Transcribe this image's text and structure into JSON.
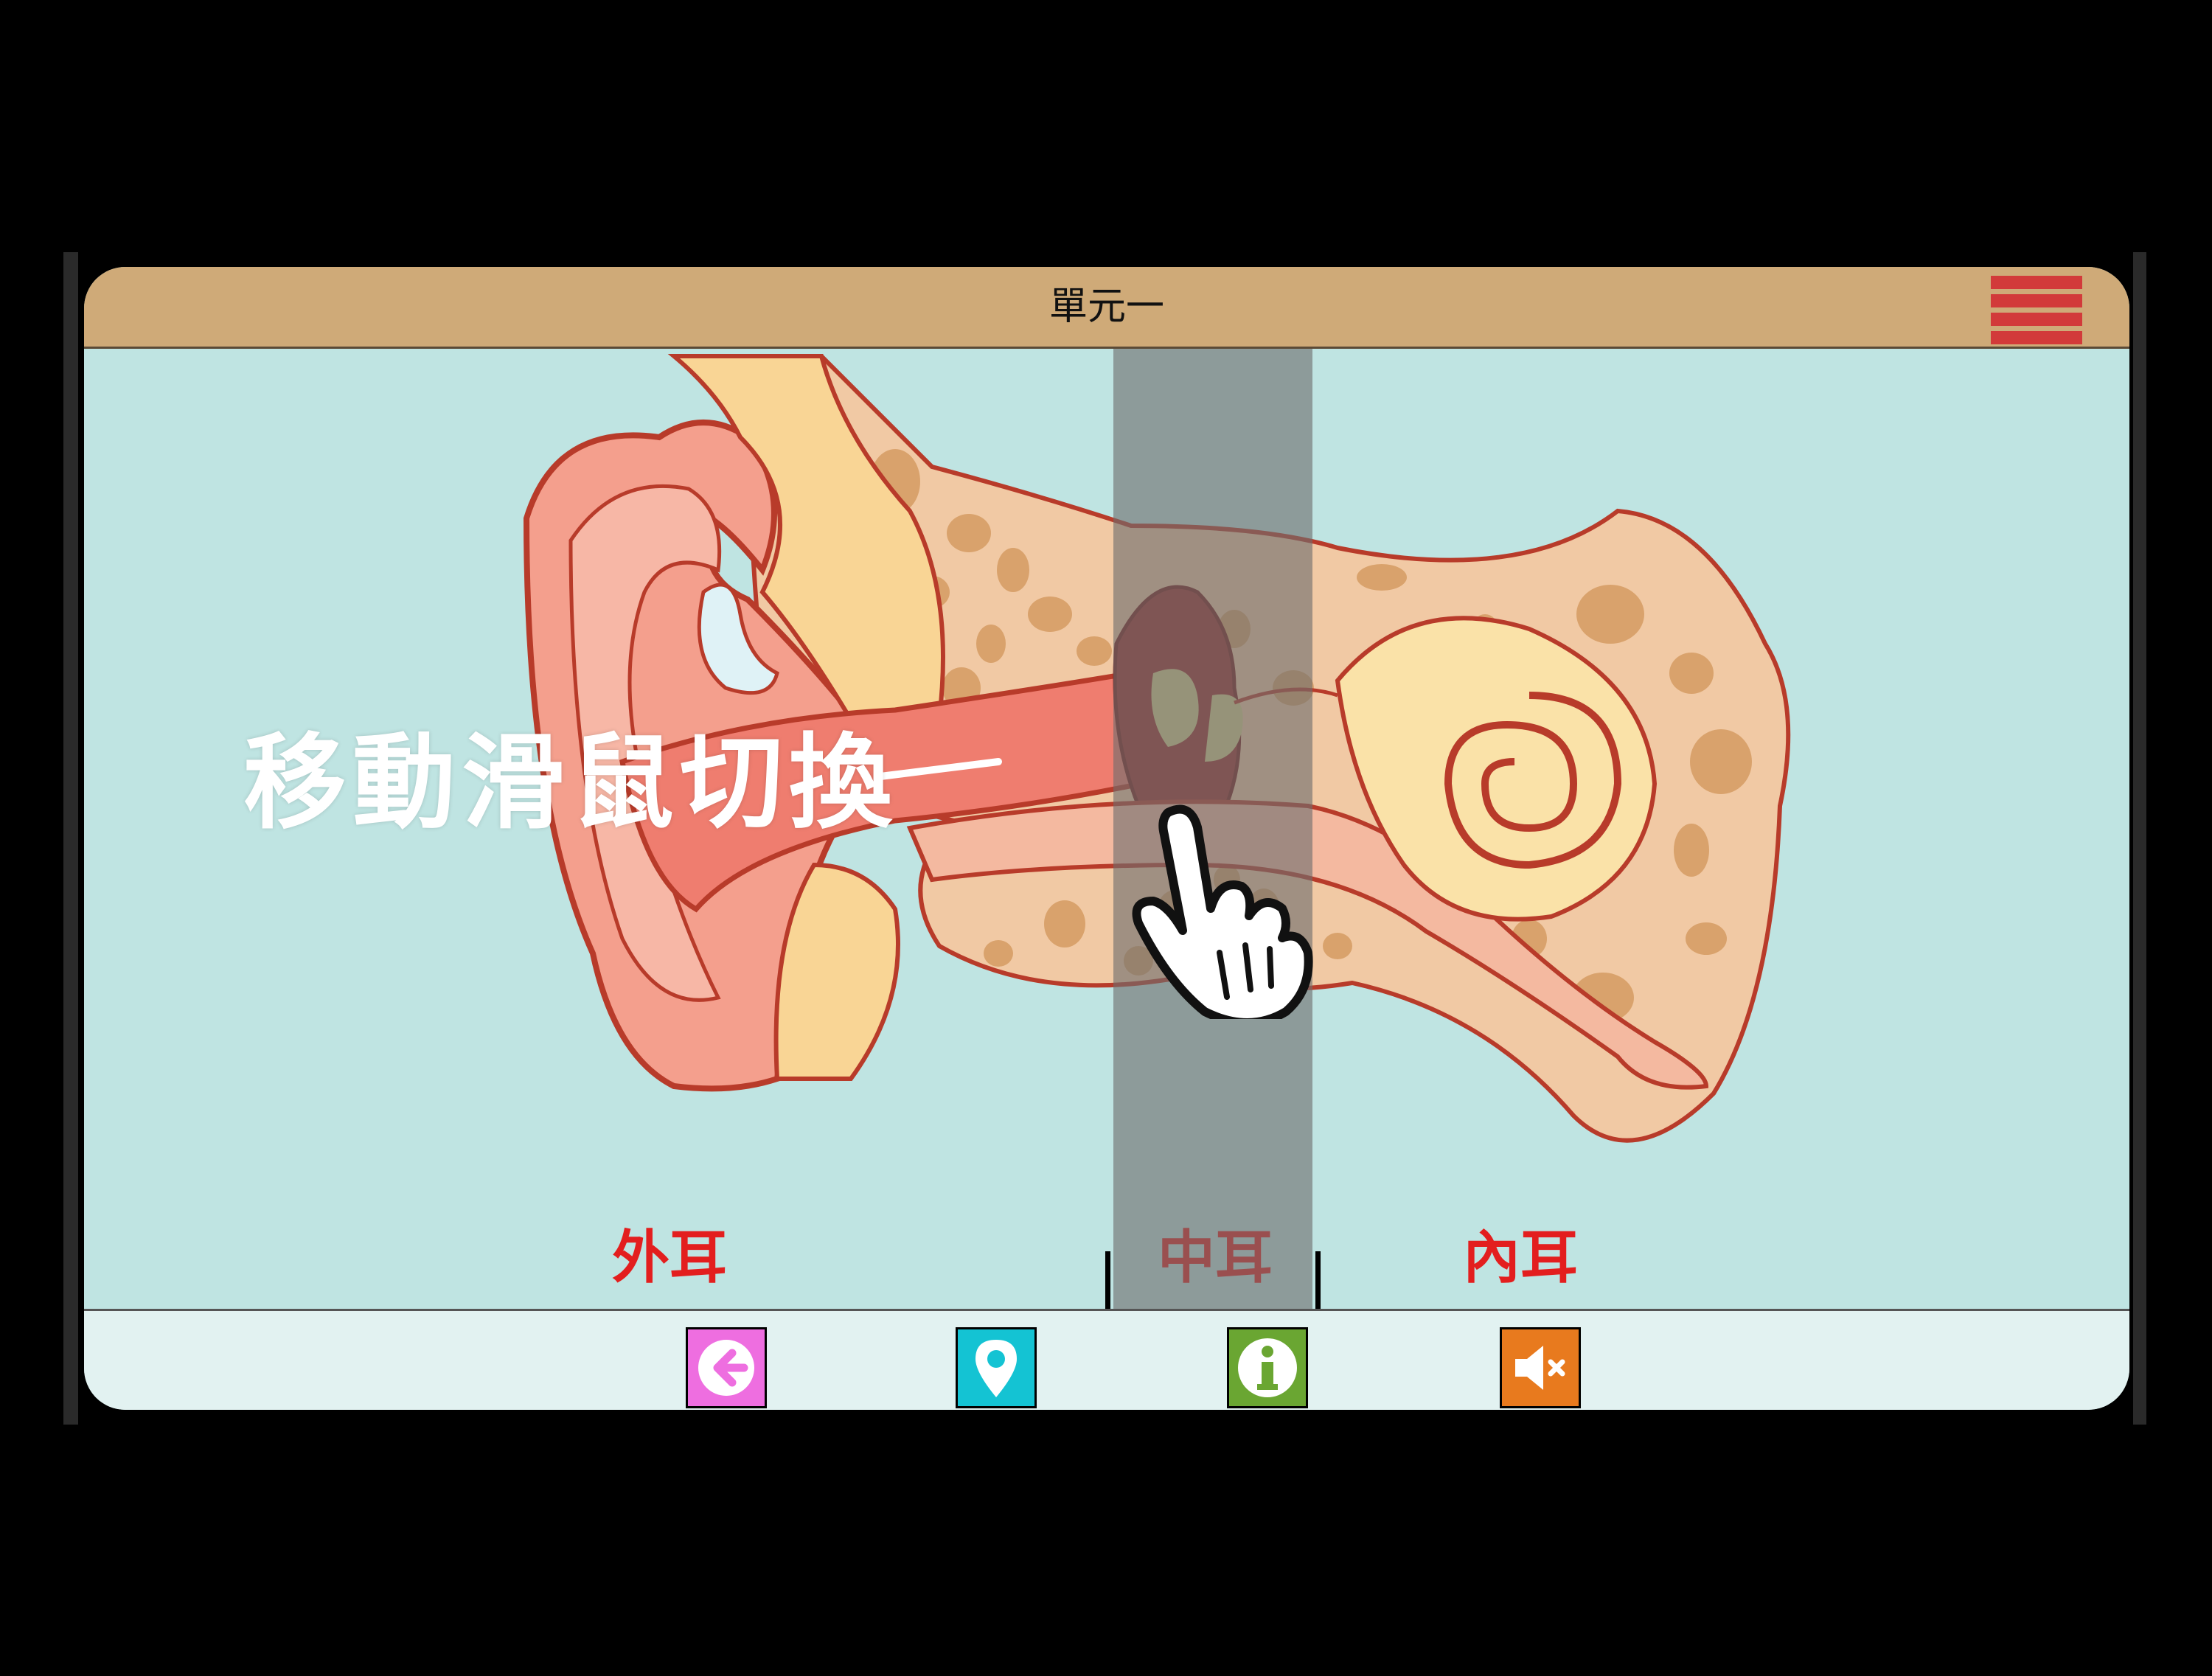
{
  "window": {
    "title": "單元一"
  },
  "overlay": {
    "hint": "移動滑鼠切換"
  },
  "regions": [
    {
      "label": "外耳"
    },
    {
      "label": "中耳"
    },
    {
      "label": "內耳"
    }
  ],
  "toolbar": {
    "buttons": [
      {
        "icon": "back-arrow-icon",
        "color": "#ee6ee0"
      },
      {
        "icon": "map-pin-icon",
        "color": "#14c3d3"
      },
      {
        "icon": "info-icon",
        "color": "#6aa632"
      },
      {
        "icon": "mute-icon",
        "color": "#e87a1e"
      }
    ]
  },
  "colors": {
    "title_bar": "#cfaa78",
    "menu": "#d23a3a",
    "background": "#bfe4e2",
    "label": "#e31e1e"
  }
}
